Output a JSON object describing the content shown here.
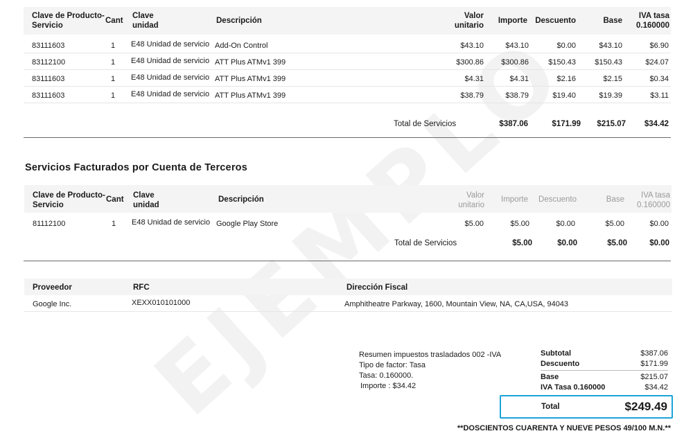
{
  "watermark": "EJEMPLO",
  "servicios": {
    "headers": {
      "clave": "Clave de Producto- Servicio",
      "cant": "Cant",
      "clave_unidad": "Clave unidad",
      "descripcion": "Descripción",
      "valor_unitario": "Valor unitario",
      "importe": "Importe",
      "descuento": "Descuento",
      "base": "Base",
      "iva_tasa": "IVA tasa 0.160000"
    },
    "rows": [
      {
        "clave": "83111603",
        "cant": "1",
        "unidad": "E48 Unidad de servicio",
        "descripcion": "Add-On Control",
        "valor_unitario": "$43.10",
        "importe": "$43.10",
        "descuento": "$0.00",
        "base": "$43.10",
        "iva": "$6.90"
      },
      {
        "clave": "83112100",
        "cant": "1",
        "unidad": "E48 Unidad de servicio",
        "descripcion": "ATT Plus ATMv1 399",
        "valor_unitario": "$300.86",
        "importe": "$300.86",
        "descuento": "$150.43",
        "base": "$150.43",
        "iva": "$24.07"
      },
      {
        "clave": "83111603",
        "cant": "1",
        "unidad": "E48 Unidad de servicio",
        "descripcion": "ATT Plus ATMv1 399",
        "valor_unitario": "$4.31",
        "importe": "$4.31",
        "descuento": "$2.16",
        "base": "$2.15",
        "iva": "$0.34"
      },
      {
        "clave": "83111603",
        "cant": "1",
        "unidad": "E48 Unidad de servicio",
        "descripcion": "ATT Plus ATMv1 399",
        "valor_unitario": "$38.79",
        "importe": "$38.79",
        "descuento": "$19.40",
        "base": "$19.39",
        "iva": "$3.11"
      }
    ],
    "total": {
      "label": "Total de Servicios",
      "importe": "$387.06",
      "descuento": "$171.99",
      "base": "$215.07",
      "iva": "$34.42"
    }
  },
  "terceros": {
    "title": "Servicios Facturados por Cuenta de Terceros",
    "headers": {
      "clave": "Clave de Producto- Servicio",
      "cant": "Cant",
      "clave_unidad": "Clave unidad",
      "descripcion": "Descripción",
      "valor_unitario": "Valor unitario",
      "importe": "Importe",
      "descuento": "Descuento",
      "base": "Base",
      "iva_tasa": "IVA tasa 0.160000"
    },
    "rows": [
      {
        "clave": "81112100",
        "cant": "1",
        "unidad": "E48 Unidad de servicio",
        "descripcion": "Google Play Store",
        "valor_unitario": "$5.00",
        "importe": "$5.00",
        "descuento": "$0.00",
        "base": "$5.00",
        "iva": "$0.00"
      }
    ],
    "total": {
      "label": "Total de Servicios",
      "importe": "$5.00",
      "descuento": "$0.00",
      "base": "$5.00",
      "iva": "$0.00"
    }
  },
  "proveedor": {
    "headers": {
      "proveedor": "Proveedor",
      "rfc": "RFC",
      "direccion": "Dirección Fiscal"
    },
    "row": {
      "proveedor": "Google Inc.",
      "rfc": "XEXX010101000",
      "direccion": "Amphitheatre Parkway, 1600, Mountain View, NA, CA,USA, 94043"
    }
  },
  "resumen": {
    "line1": "Resumen impuestos trasladados 002 -IVA",
    "line2": "Tipo de factor: Tasa",
    "line3": "Tasa: 0.160000.",
    "line4": "Importe : $34.42"
  },
  "totales": {
    "subtotal_label": "Subtotal",
    "subtotal": "$387.06",
    "descuento_label": "Descuento",
    "descuento": "$171.99",
    "base_label": "Base",
    "base": "$215.07",
    "iva_label": "IVA Tasa 0.160000",
    "iva": "$34.42",
    "total_label": "Total",
    "total": "$249.49",
    "letras": "**DOSCIENTOS CUARENTA Y NUEVE PESOS 49/100 M.N.**"
  }
}
